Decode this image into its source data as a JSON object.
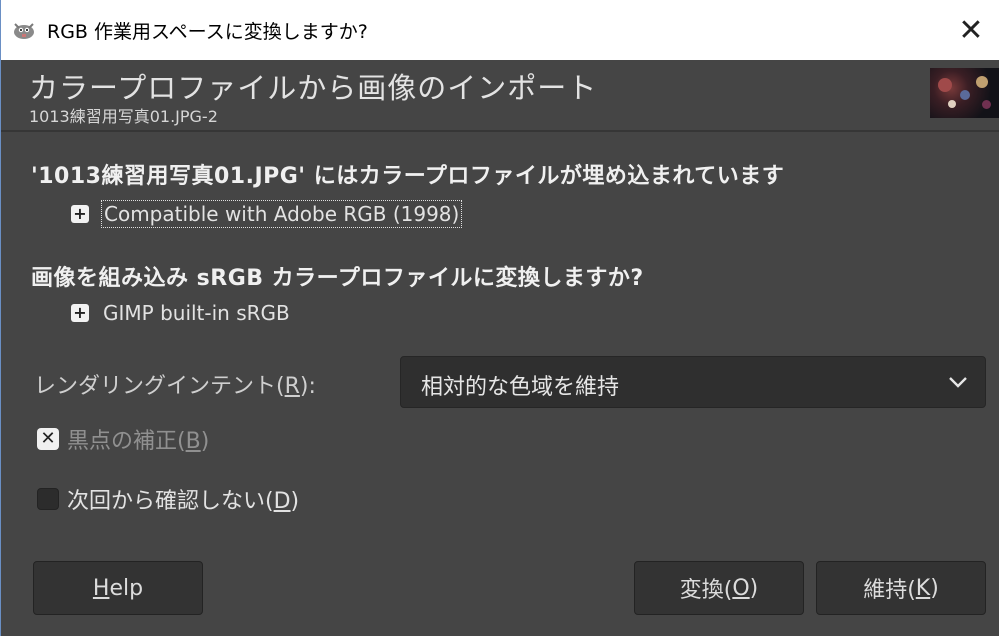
{
  "window": {
    "title": "RGB 作業用スペースに変換しますか?",
    "close_glyph": "✕"
  },
  "header": {
    "title": "カラープロファイルから画像のインポート",
    "subtitle": "1013練習用写真01.JPG-2"
  },
  "embedded": {
    "message": "'1013練習用写真01.JPG' にはカラープロファイルが埋め込まれています",
    "profile_name": "Compatible with Adobe RGB (1998)",
    "expander_glyph": "+"
  },
  "convert": {
    "question": "画像を組み込み sRGB カラープロファイルに変換しますか?",
    "profile_name": "GIMP built-in sRGB",
    "expander_glyph": "+"
  },
  "rendering_intent": {
    "label_pre": "レンダリングインテント(",
    "label_key": "R",
    "label_post": "):",
    "selected": "相対的な色域を維持"
  },
  "black_point": {
    "label_pre": "黒点の補正(",
    "label_key": "B",
    "label_post": ")",
    "checked": true,
    "enabled": false,
    "check_glyph": "✕"
  },
  "dont_ask": {
    "label_pre": "次回から確認しない(",
    "label_key": "D",
    "label_post": ")",
    "checked": false
  },
  "buttons": {
    "help_key": "H",
    "help_rest": "elp",
    "convert_pre": "変換(",
    "convert_key": "O",
    "convert_post": ")",
    "keep_pre": "維持(",
    "keep_key": "K",
    "keep_post": ")"
  },
  "colors": {
    "dialog_bg": "#454545",
    "titlebar_bg": "#ffffff",
    "desktop_bg": "#2b4a78"
  }
}
